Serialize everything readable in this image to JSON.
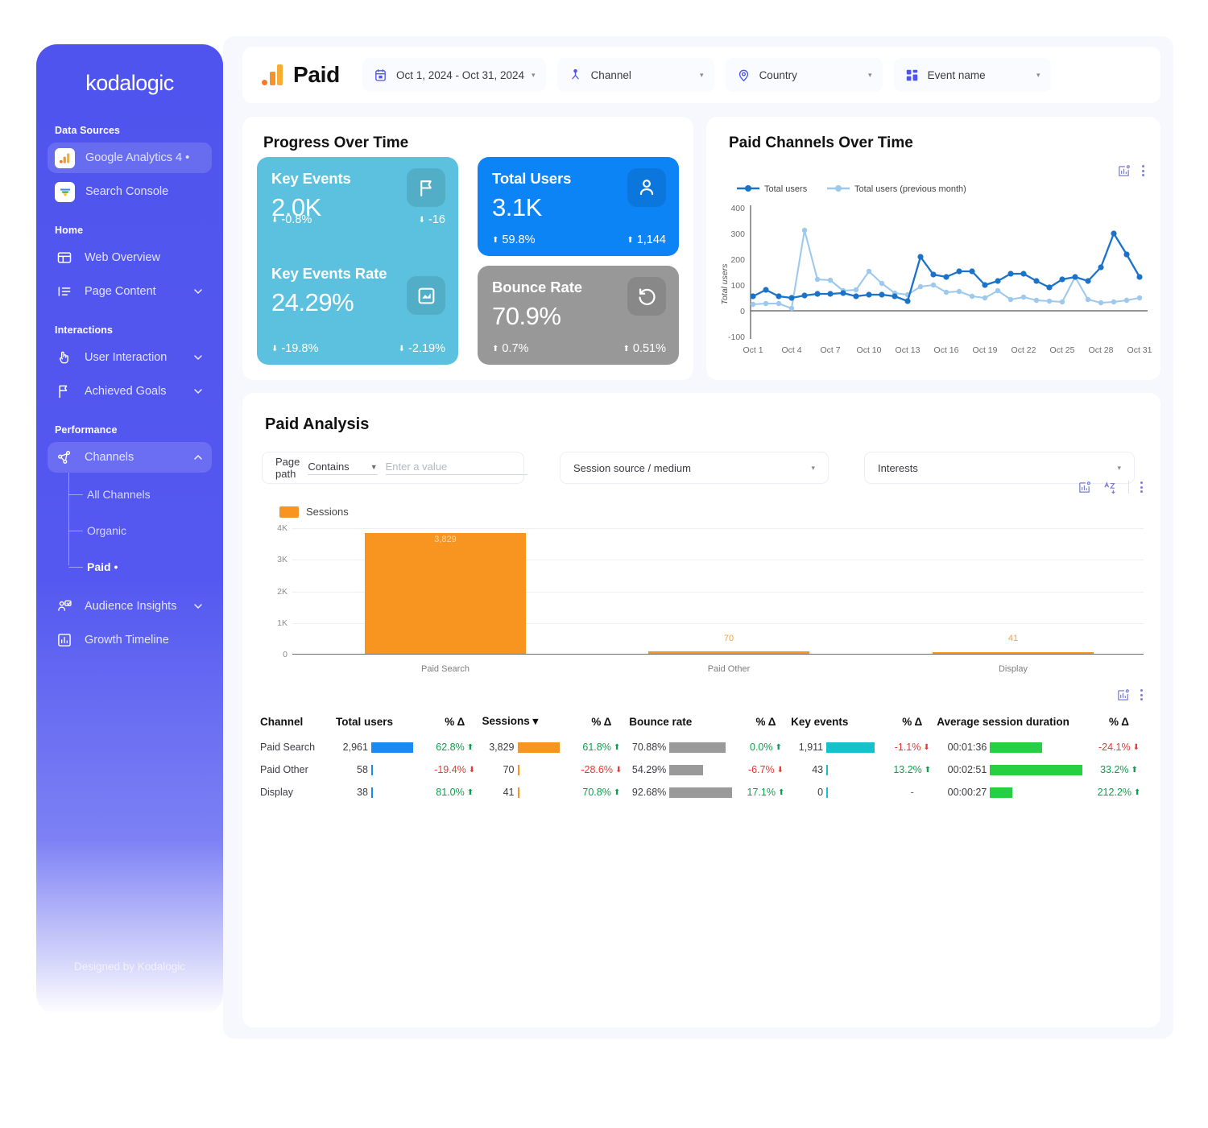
{
  "sidebar": {
    "brand": "kodalogic",
    "footer": "Designed by Kodalogic",
    "sections": [
      {
        "label": "Data Sources"
      },
      {
        "label": "Home"
      },
      {
        "label": "Interactions"
      },
      {
        "label": "Performance"
      }
    ],
    "items": {
      "ga4": "Google Analytics 4 •",
      "search_console": "Search Console",
      "web_overview": "Web Overview",
      "page_content": "Page Content",
      "user_interaction": "User Interaction",
      "achieved_goals": "Achieved Goals",
      "channels": "Channels",
      "all_channels": "All Channels",
      "organic": "Organic",
      "paid": "Paid •",
      "audience_insights": "Audience Insights",
      "growth_timeline": "Growth Timeline"
    }
  },
  "header": {
    "title": "Paid",
    "filters": [
      {
        "name": "date-range",
        "label": "Oct 1, 2024 - Oct 31, 2024",
        "icon": "calendar-icon"
      },
      {
        "name": "channel",
        "label": "Channel",
        "icon": "person-network-icon"
      },
      {
        "name": "country",
        "label": "Country",
        "icon": "location-pin-icon"
      },
      {
        "name": "event-name",
        "label": "Event name",
        "icon": "grid-blocks-icon"
      }
    ]
  },
  "progress": {
    "title": "Progress Over Time",
    "kpis": [
      {
        "name": "total-users",
        "title": "Total Users",
        "value": "3.1K",
        "delta_pct": "59.8%",
        "delta_pct_dir": "up",
        "delta_abs": "1,144",
        "delta_abs_dir": "up",
        "icon": "person-icon",
        "color": "#0d84f5"
      },
      {
        "name": "bounce-rate",
        "title": "Bounce Rate",
        "value": "70.9%",
        "delta_pct": "0.7%",
        "delta_pct_dir": "up",
        "delta_abs": "0.51%",
        "delta_abs_dir": "up",
        "icon": "undo-icon",
        "color": "#989898"
      },
      {
        "name": "key-events",
        "title": "Key Events",
        "value": "2.0K",
        "delta_pct": "-0.8%",
        "delta_pct_dir": "down",
        "delta_abs": "-16",
        "delta_abs_dir": "down",
        "icon": "flag-icon",
        "color": "#5cc1de"
      },
      {
        "name": "key-events-rate",
        "title": "Key Events Rate",
        "value": "24.29%",
        "delta_pct": "-19.8%",
        "delta_pct_dir": "down",
        "delta_abs": "-2.19%",
        "delta_abs_dir": "down",
        "icon": "area-chart-icon",
        "color": "#5cc1de"
      }
    ]
  },
  "paid_channels": {
    "title": "Paid Channels Over Time"
  },
  "analysis": {
    "title": "Paid Analysis",
    "page_path_label": "Page path",
    "page_path_operator": "Contains",
    "page_path_placeholder": "Enter a value",
    "page_path_value": "",
    "session_source": "Session source / medium",
    "interests": "Interests"
  },
  "table": {
    "columns": [
      "Channel",
      "Total users",
      "% Δ",
      "Sessions  ▾",
      "% Δ",
      "Bounce rate",
      "% Δ",
      "Key events",
      "% Δ",
      "Average session duration",
      "% Δ"
    ],
    "rows": [
      {
        "channel": "Paid Search",
        "total_users": "2,961",
        "total_users_delta": "62.8%",
        "total_users_dir": "up",
        "sessions": "3,829",
        "sessions_delta": "61.8%",
        "sessions_dir": "up",
        "bounce_rate": "70.88%",
        "bounce_rate_delta": "0.0%",
        "bounce_rate_dir": "up",
        "key_events": "1,911",
        "key_events_delta": "-1.1%",
        "key_events_dir": "down",
        "avg_duration": "00:01:36",
        "avg_duration_delta": "-24.1%",
        "avg_duration_dir": "down"
      },
      {
        "channel": "Paid Other",
        "total_users": "58",
        "total_users_delta": "-19.4%",
        "total_users_dir": "down",
        "sessions": "70",
        "sessions_delta": "-28.6%",
        "sessions_dir": "down",
        "bounce_rate": "54.29%",
        "bounce_rate_delta": "-6.7%",
        "bounce_rate_dir": "down",
        "key_events": "43",
        "key_events_delta": "13.2%",
        "key_events_dir": "up",
        "avg_duration": "00:02:51",
        "avg_duration_delta": "33.2%",
        "avg_duration_dir": "up"
      },
      {
        "channel": "Display",
        "total_users": "38",
        "total_users_delta": "81.0%",
        "total_users_dir": "up",
        "sessions": "41",
        "sessions_delta": "70.8%",
        "sessions_dir": "up",
        "bounce_rate": "92.68%",
        "bounce_rate_delta": "17.1%",
        "bounce_rate_dir": "up",
        "key_events": "0",
        "key_events_delta": "-",
        "key_events_dir": "none",
        "avg_duration": "00:00:27",
        "avg_duration_delta": "212.2%",
        "avg_duration_dir": "up"
      }
    ]
  },
  "chart_data": [
    {
      "name": "paid-channels-over-time",
      "type": "line",
      "title": "Paid Channels Over Time",
      "xlabel": "",
      "ylabel": "Total users",
      "ylim": [
        -100,
        400
      ],
      "yticks": [
        -100,
        0,
        100,
        200,
        300,
        400
      ],
      "grid": false,
      "legend_position": "top-left",
      "x": [
        "Oct 1",
        "Oct 2",
        "Oct 3",
        "Oct 4",
        "Oct 5",
        "Oct 6",
        "Oct 7",
        "Oct 8",
        "Oct 9",
        "Oct 10",
        "Oct 11",
        "Oct 12",
        "Oct 13",
        "Oct 14",
        "Oct 15",
        "Oct 16",
        "Oct 17",
        "Oct 18",
        "Oct 19",
        "Oct 20",
        "Oct 21",
        "Oct 22",
        "Oct 23",
        "Oct 24",
        "Oct 25",
        "Oct 26",
        "Oct 27",
        "Oct 28",
        "Oct 29",
        "Oct 30",
        "Oct 31"
      ],
      "xticks": [
        "Oct 1",
        "Oct 4",
        "Oct 7",
        "Oct 10",
        "Oct 13",
        "Oct 16",
        "Oct 19",
        "Oct 22",
        "Oct 25",
        "Oct 28",
        "Oct 31"
      ],
      "series": [
        {
          "name": "Total users",
          "color": "#1a73c8",
          "values": [
            55,
            82,
            55,
            51,
            61,
            67,
            67,
            68,
            57,
            64,
            62,
            57,
            38,
            210,
            140,
            130,
            153,
            153,
            100,
            117,
            145,
            143,
            115,
            90,
            122,
            130,
            116,
            168,
            300,
            218,
            130
          ]
        },
        {
          "name": "Total users (previous month)",
          "color": "#9ec9ee",
          "values": [
            25,
            28,
            27,
            10,
            313,
            123,
            120,
            78,
            82,
            152,
            107,
            68,
            64,
            95,
            100,
            71,
            74,
            55,
            48,
            77,
            44,
            54,
            46,
            38,
            36,
            130,
            44,
            30,
            33,
            42,
            50
          ]
        }
      ]
    },
    {
      "name": "paid-analysis-sessions",
      "type": "bar",
      "title": "",
      "legend": [
        "Sessions"
      ],
      "legend_position": "top-left",
      "categories": [
        "Paid Search",
        "Paid Other",
        "Display"
      ],
      "values": [
        3829,
        70,
        41
      ],
      "value_labels": [
        "3,829",
        "70",
        "41"
      ],
      "color": "#f89520",
      "xlabel": "",
      "ylabel": "",
      "ylim": [
        0,
        4000
      ],
      "yticks": [
        0,
        1000,
        2000,
        3000,
        4000
      ],
      "ytick_labels": [
        "0",
        "1K",
        "2K",
        "3K",
        "4K"
      ],
      "grid": true
    }
  ]
}
